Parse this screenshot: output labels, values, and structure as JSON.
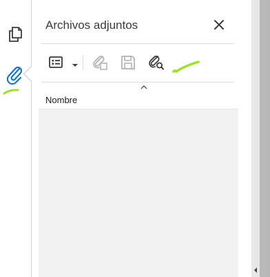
{
  "panel": {
    "title": "Archivos adjuntos",
    "close_label": "✕"
  },
  "rail": {
    "items": [
      {
        "name": "pages",
        "icon": "pages-icon"
      },
      {
        "name": "attachments",
        "icon": "paperclip-icon",
        "active": true
      }
    ]
  },
  "toolbar": {
    "items": [
      {
        "name": "options",
        "icon": "options-list-icon",
        "enabled": true
      },
      {
        "name": "open",
        "icon": "open-attachment-icon",
        "enabled": false
      },
      {
        "name": "save",
        "icon": "save-attachment-icon",
        "enabled": false
      },
      {
        "name": "search",
        "icon": "search-attachment-icon",
        "enabled": true
      }
    ]
  },
  "table": {
    "columns": [
      "Nombre"
    ],
    "sort_column": "Nombre",
    "sort_direction": "ascending",
    "rows": []
  },
  "colors": {
    "accent": "#1a73c7",
    "highlighter": "#9be225",
    "icon_active": "#3a3a3a",
    "icon_disabled": "#b4b4b4",
    "list_background": "#f2f2f2"
  }
}
